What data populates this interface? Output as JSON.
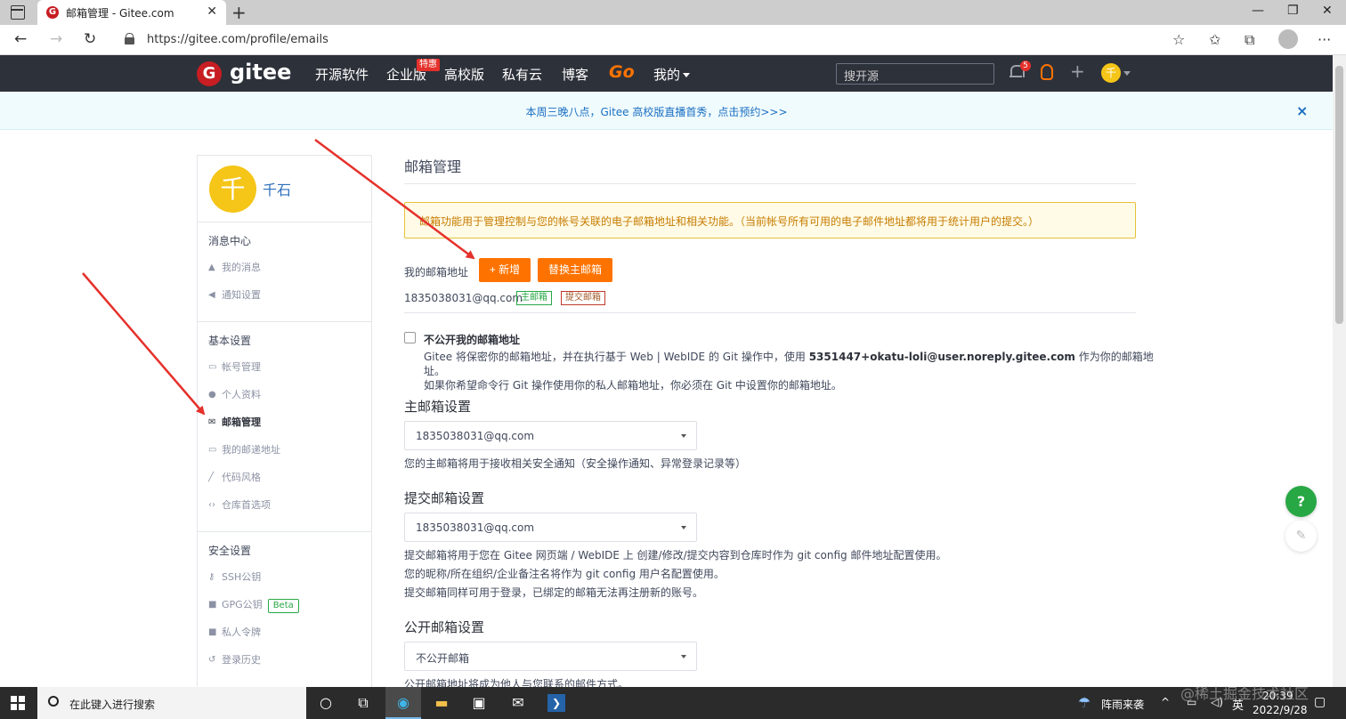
{
  "browser": {
    "tab_title": "邮箱管理 - Gitee.com",
    "url": "https://gitee.com/profile/emails"
  },
  "header": {
    "logo_text": "gitee",
    "nav": [
      "开源软件",
      "企业版",
      "高校版",
      "私有云",
      "博客"
    ],
    "hot_badge": "特惠",
    "go": "Go",
    "mine": "我的",
    "search_placeholder": "搜开源",
    "notification_count": "5",
    "avatar_char": "千"
  },
  "banner": {
    "text": "本周三晚八点，Gitee 高校版直播首秀，点击预约>>>",
    "close": "×"
  },
  "sidebar": {
    "avatar_char": "千",
    "username": "千石",
    "groups": [
      {
        "title": "消息中心",
        "items": [
          "我的消息",
          "通知设置"
        ]
      },
      {
        "title": "基本设置",
        "items": [
          "帐号管理",
          "个人资料",
          "邮箱管理",
          "我的邮递地址",
          "代码风格",
          "仓库首选项"
        ]
      },
      {
        "title": "安全设置",
        "items": [
          "SSH公钥",
          "GPG公钥",
          "私人令牌",
          "登录历史"
        ]
      }
    ],
    "beta": "Beta"
  },
  "main": {
    "title": "邮箱管理",
    "warning": "邮箱功能用于管理控制与您的帐号关联的电子邮箱地址和相关功能。（当前帐号所有可用的电子邮件地址都将用于统计用户的提交。）",
    "my_emails_label": "我的邮箱地址",
    "add_button": "+ 新增",
    "replace_button": "替换主邮箱",
    "email": "1835038031@qq.com",
    "tag_primary": "主邮箱",
    "tag_commit": "提交邮箱",
    "hide_email_label": "不公开我的邮箱地址",
    "hide_desc_1a": "Gitee 将保密你的邮箱地址，并在执行基于 Web | WebIDE 的 Git 操作中，使用 ",
    "hide_desc_bold": "5351447+okatu-loli@user.noreply.gitee.com",
    "hide_desc_1b": " 作为你的邮箱地址。",
    "hide_desc_2": "如果你希望命令行 Git 操作使用你的私人邮箱地址，你必须在 Git 中设置你的邮箱地址。",
    "primary_title": "主邮箱设置",
    "primary_select": "1835038031@qq.com",
    "primary_help": "您的主邮箱将用于接收相关安全通知（安全操作通知、异常登录记录等）",
    "commit_title": "提交邮箱设置",
    "commit_select": "1835038031@qq.com",
    "commit_help_1": "提交邮箱将用于您在 Gitee 网页端 / WebIDE 上 创建/修改/提交内容到仓库时作为 git config 邮件地址配置使用。",
    "commit_help_2": "您的昵称/所在组织/企业备注名将作为 git config 用户名配置使用。",
    "commit_help_3": "提交邮箱同样可用于登录，已绑定的邮箱无法再注册新的账号。",
    "public_title": "公开邮箱设置",
    "public_select": "不公开邮箱",
    "public_help": "公开邮箱地址将成为他人与您联系的邮件方式。"
  },
  "floating": {
    "help": "?"
  },
  "taskbar": {
    "search_text": "在此键入进行搜索",
    "weather": "阵雨来袭",
    "ime": "英",
    "time": "20:39",
    "date": "2022/9/28"
  },
  "watermark": "@稀土掘金技术社区",
  "colors": {
    "accent": "#fe7300",
    "header_bg": "#2d313a",
    "brand": "#c71d23",
    "annotation_arrow": "#e5312b"
  }
}
